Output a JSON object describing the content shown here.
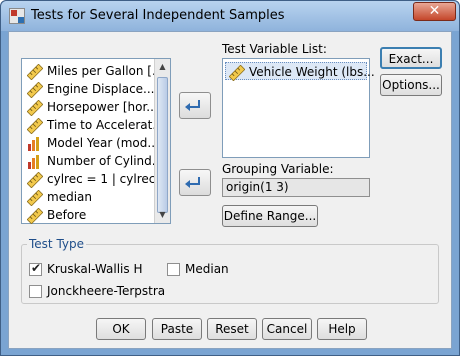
{
  "window": {
    "title": "Tests for Several Independent Samples",
    "close_label": "✕"
  },
  "variables_list": {
    "items": [
      {
        "label": "Miles per Gallon [...",
        "icon": "ruler-icon"
      },
      {
        "label": "Engine Displace...",
        "icon": "ruler-icon"
      },
      {
        "label": "Horsepower [hor...",
        "icon": "ruler-icon"
      },
      {
        "label": "Time to Accelerat...",
        "icon": "ruler-icon"
      },
      {
        "label": "Model Year (mod...",
        "icon": "bar-chart-icon"
      },
      {
        "label": "Number of Cylind...",
        "icon": "bar-chart-icon"
      },
      {
        "label": "cylrec = 1 | cylrec ...",
        "icon": "ruler-icon"
      },
      {
        "label": "median",
        "icon": "ruler-icon"
      },
      {
        "label": "Before",
        "icon": "ruler-icon"
      }
    ]
  },
  "test_variable": {
    "label": "Test Variable List:",
    "items": [
      {
        "label": "Vehicle Weight (lbs...",
        "icon": "ruler-icon"
      }
    ]
  },
  "grouping_variable": {
    "label": "Grouping Variable:",
    "value": "origin(1 3)"
  },
  "buttons": {
    "exact": "Exact...",
    "options": "Options...",
    "define_range": "Define Range..."
  },
  "test_type": {
    "title": "Test Type",
    "kruskal": {
      "label": "Kruskal-Wallis H",
      "checked": true
    },
    "median": {
      "label": "Median",
      "checked": false
    },
    "jonckheere": {
      "label": "Jonckheere-Terpstra",
      "checked": false
    }
  },
  "footer": {
    "ok": "OK",
    "paste": "Paste",
    "reset": "Reset",
    "cancel": "Cancel",
    "help": "Help"
  }
}
